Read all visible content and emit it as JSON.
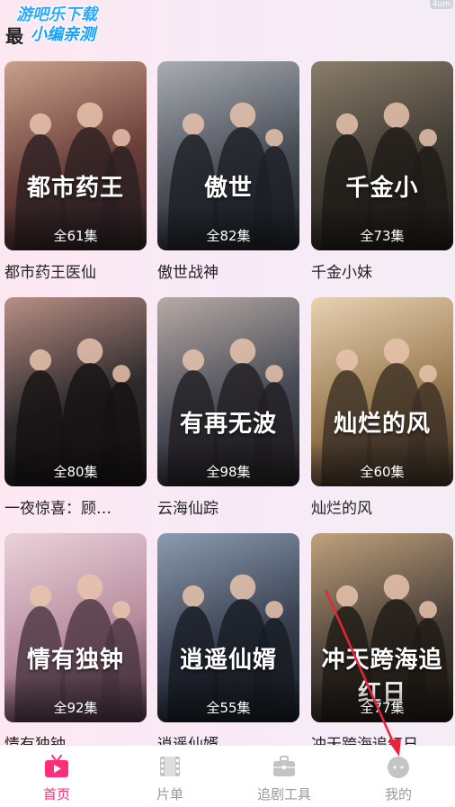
{
  "header": {
    "section_title": "最",
    "watermark_line1": "游吧乐下载",
    "watermark_line2": "小编亲测",
    "status_badge": "4um"
  },
  "dramas": [
    {
      "title": "都市药王医仙",
      "episodes": "全61集",
      "art": "都市药王",
      "palette": [
        "#6b3f3a",
        "#c9a08a",
        "#2a1f22"
      ]
    },
    {
      "title": "傲世战神",
      "episodes": "全82集",
      "art": "傲世",
      "palette": [
        "#4b4f58",
        "#a9adb3",
        "#1c1f24"
      ]
    },
    {
      "title": "千金小妹",
      "episodes": "全73集",
      "art": "千金小",
      "palette": [
        "#3f3a33",
        "#8a7d6a",
        "#1e1a16"
      ]
    },
    {
      "title": "一夜惊喜：顾…",
      "episodes": "全80集",
      "art": "",
      "palette": [
        "#2e2a2c",
        "#b98f85",
        "#151213"
      ]
    },
    {
      "title": "云海仙踪",
      "episodes": "全98集",
      "art": "有再无波",
      "palette": [
        "#4a4d57",
        "#b7aaa5",
        "#201e22"
      ]
    },
    {
      "title": "灿烂的风",
      "episodes": "全60集",
      "art": "灿烂的风",
      "palette": [
        "#9a7c52",
        "#e8d2b3",
        "#3b2e24"
      ]
    },
    {
      "title": "情有独钟",
      "episodes": "全92集",
      "art": "情有独钟",
      "palette": [
        "#b88d9e",
        "#ead2da",
        "#4a3440"
      ]
    },
    {
      "title": "逍遥仙婿",
      "episodes": "全55集",
      "art": "逍遥仙婿",
      "palette": [
        "#3a4252",
        "#8c9bb0",
        "#161a22"
      ]
    },
    {
      "title": "冲天跨海追红日",
      "episodes": "全77集",
      "art": "冲天跨海追红日",
      "palette": [
        "#4a4039",
        "#c0a27c",
        "#1e1914"
      ]
    }
  ],
  "nav": [
    {
      "label": "首页",
      "icon": "tv-icon",
      "active": true
    },
    {
      "label": "片单",
      "icon": "film-icon",
      "active": false
    },
    {
      "label": "追剧工具",
      "icon": "briefcase-icon",
      "active": false
    },
    {
      "label": "我的",
      "icon": "profile-face-icon",
      "active": false
    }
  ],
  "colors": {
    "accent": "#ff2d7a",
    "inactive": "#9a9a9a",
    "annotation_arrow": "#e8243a"
  }
}
